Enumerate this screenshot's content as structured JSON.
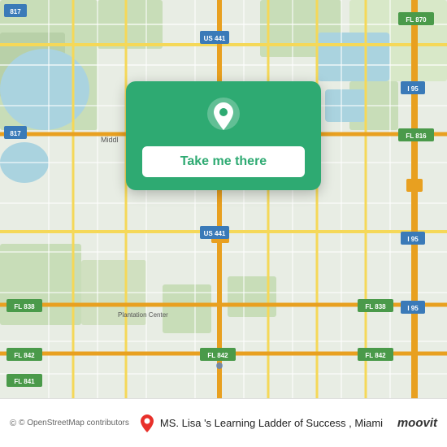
{
  "map": {
    "background_color": "#e8eee8",
    "attribution": "© OpenStreetMap contributors"
  },
  "cta": {
    "button_label": "Take me there",
    "pin_icon": "location-pin"
  },
  "bottom_bar": {
    "attribution_text": "© OpenStreetMap contributors",
    "place_name": "MS. Lisa 's Learning Ladder of Success",
    "city": "Miami",
    "app_name": "moovit"
  }
}
